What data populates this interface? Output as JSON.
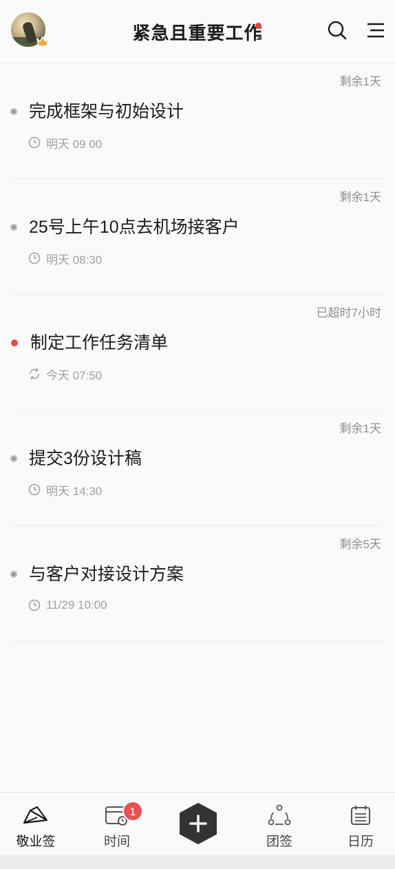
{
  "header": {
    "title": "紧急且重要工作",
    "avatar_icon": "user-avatar",
    "badge_icon": "vip-crown-icon",
    "search_icon": "search-icon",
    "menu_icon": "menu-icon",
    "accent_color": "#e64545"
  },
  "tasks": [
    {
      "name": "完成框架与初始设计",
      "remaining": "剩余1天",
      "due": "明天 09 00",
      "icon": "clock-icon",
      "overdue": false
    },
    {
      "name": "25号上午10点去机场接客户",
      "remaining": "剩余1天",
      "due": "明天 08:30",
      "icon": "clock-icon",
      "overdue": false
    },
    {
      "name": "制定工作任务清单",
      "remaining": "已超时7小时",
      "due": "今天 07:50",
      "icon": "repeat-icon",
      "overdue": true
    },
    {
      "name": "提交3份设计稿",
      "remaining": "剩余1天",
      "due": "明天 14:30",
      "icon": "clock-icon",
      "overdue": false
    },
    {
      "name": "与客户对接设计方案",
      "remaining": "剩余5天",
      "due": "11/29 10:00",
      "icon": "clock-icon",
      "overdue": false
    }
  ],
  "bottom_nav": {
    "items": [
      {
        "label": "敬业签",
        "icon": "paper-plane-icon",
        "active": true
      },
      {
        "label": "时间",
        "icon": "calendar-clock-icon",
        "badge": "1"
      },
      {
        "label": "团签",
        "icon": "team-icon"
      },
      {
        "label": "日历",
        "icon": "calendar-icon"
      }
    ],
    "add_icon": "plus-hexagon-icon",
    "badge_color": "#e95050"
  }
}
